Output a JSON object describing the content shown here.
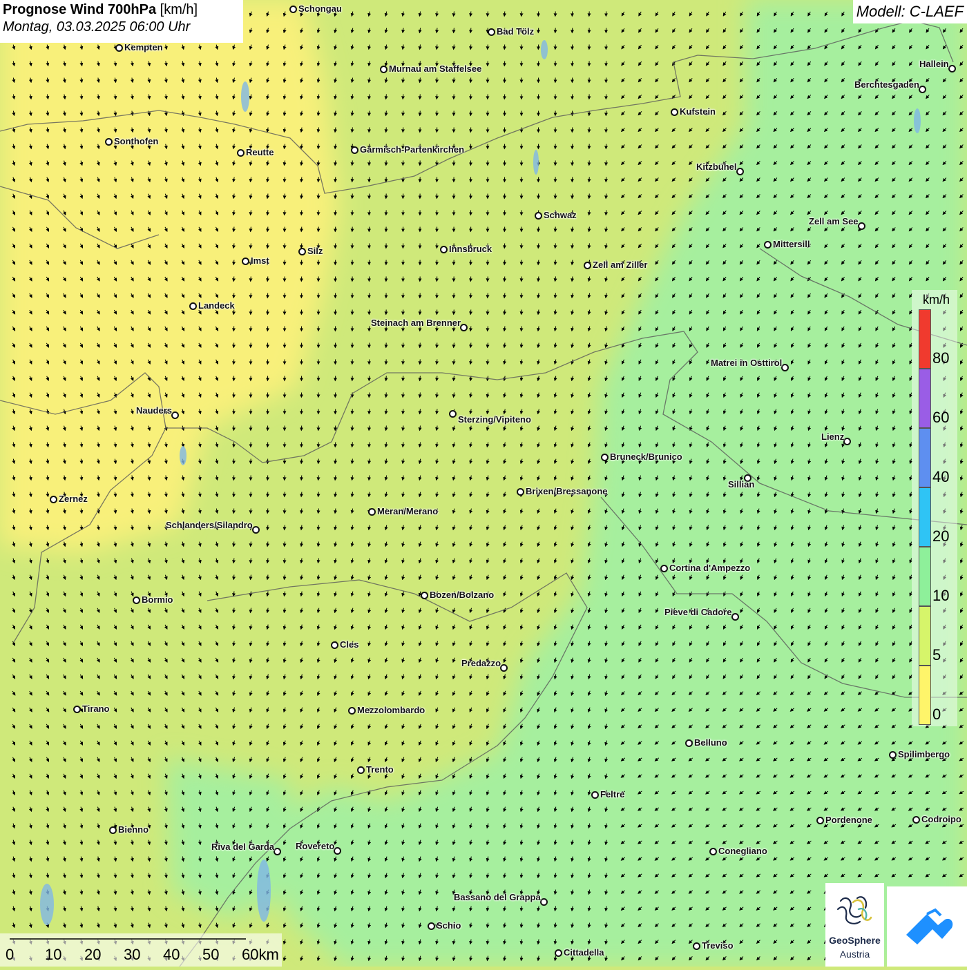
{
  "title": {
    "main": "Prognose Wind 700hPa",
    "unit": "[km/h]",
    "datetime": "Montag, 03.03.2025 06:00 Uhr"
  },
  "model_label": "Modell: C-LAEF",
  "legend": {
    "unit": "km/h",
    "ticks": [
      "80",
      "60",
      "40",
      "20",
      "10",
      "5",
      "0"
    ],
    "colors": [
      "#f03a2e",
      "#9a5de6",
      "#5e8ff0",
      "#2fc4f5",
      "#8ef09a",
      "#d6f56a",
      "#fef56a"
    ]
  },
  "scale": {
    "labels": [
      "0",
      "10",
      "20",
      "30",
      "40",
      "50",
      "60km"
    ]
  },
  "logos": {
    "geosphere_line1": "GeoSphere",
    "geosphere_line2": "Austria",
    "icons": [
      "geosphere-logo-icon",
      "cloud-arrow-logo-icon"
    ]
  },
  "colors": {
    "calm_yellow": "#f8f07a",
    "light_green": "#cfe97a",
    "green_10": "#a6ef9e"
  },
  "cities": [
    {
      "name": "Schongau"
    },
    {
      "name": "Bad Tölz"
    },
    {
      "name": "Kempten"
    },
    {
      "name": "Murnau am Staffelsee"
    },
    {
      "name": "Hallein"
    },
    {
      "name": "Berchtesgaden"
    },
    {
      "name": "Kufstein"
    },
    {
      "name": "Sonthofen"
    },
    {
      "name": "Reutte"
    },
    {
      "name": "Garmisch-Partenkirchen"
    },
    {
      "name": "Kitzbühel"
    },
    {
      "name": "Schwaz"
    },
    {
      "name": "Zell am See"
    },
    {
      "name": "Mittersill"
    },
    {
      "name": "Silz"
    },
    {
      "name": "Innsbruck"
    },
    {
      "name": "Imst"
    },
    {
      "name": "Zell am Ziller"
    },
    {
      "name": "Landeck"
    },
    {
      "name": "Steinach am Brenner"
    },
    {
      "name": "Matrei in Osttirol"
    },
    {
      "name": "Nauders"
    },
    {
      "name": "Sterzing/Vipiteno"
    },
    {
      "name": "Lienz"
    },
    {
      "name": "Bruneck/Brunico"
    },
    {
      "name": "Sillian"
    },
    {
      "name": "Brixen/Bressanone"
    },
    {
      "name": "Zernez"
    },
    {
      "name": "Meran/Merano"
    },
    {
      "name": "Schlanders/Silandro"
    },
    {
      "name": "Cortina d'Ampezzo"
    },
    {
      "name": "Bozen/Bolzano"
    },
    {
      "name": "Bormio"
    },
    {
      "name": "Pieve di Cadore"
    },
    {
      "name": "Cles"
    },
    {
      "name": "Predazzo"
    },
    {
      "name": "Tirano"
    },
    {
      "name": "Mezzolombardo"
    },
    {
      "name": "Belluno"
    },
    {
      "name": "Spilimbergo"
    },
    {
      "name": "Trento"
    },
    {
      "name": "Feltre"
    },
    {
      "name": "Pordenone"
    },
    {
      "name": "Codroipo"
    },
    {
      "name": "Bienno"
    },
    {
      "name": "Riva del Garda"
    },
    {
      "name": "Rovereto"
    },
    {
      "name": "Conegliano"
    },
    {
      "name": "Bassano del Grappa"
    },
    {
      "name": "Schio"
    },
    {
      "name": "Treviso"
    },
    {
      "name": "Cittadella"
    }
  ]
}
